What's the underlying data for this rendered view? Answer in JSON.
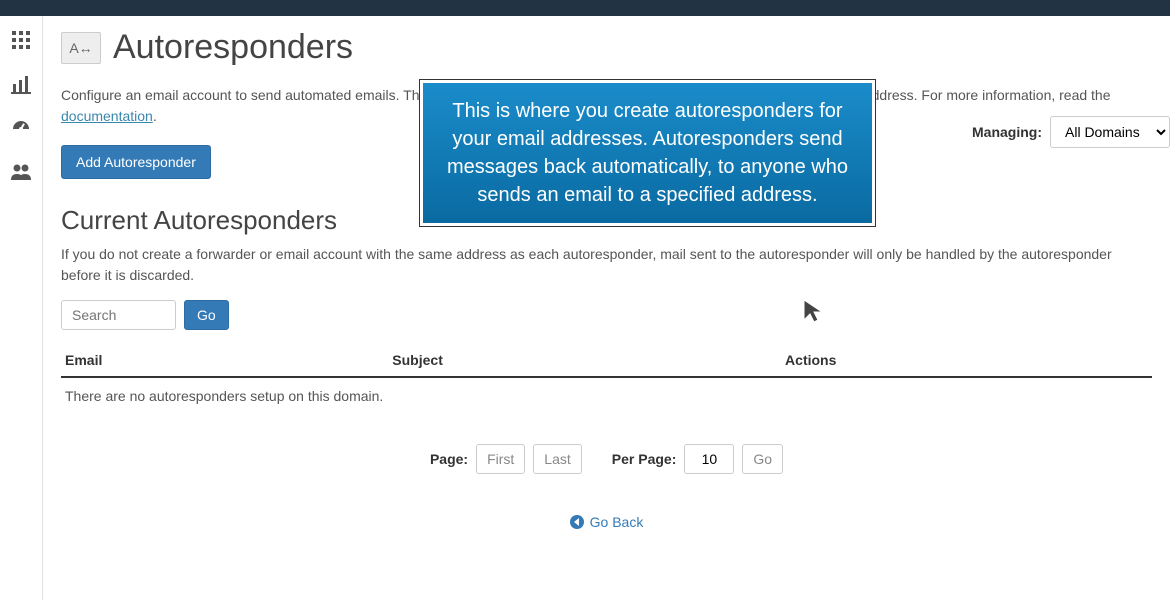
{
  "page": {
    "title": "Autoresponders",
    "icon_label": "A↔"
  },
  "managing": {
    "label": "Managing:",
    "selected": "All Domains"
  },
  "intro": {
    "text_before": "Configure an email account to send automated emails. This can be useful ... message that you wish to send from a support email address. For more information, read the ",
    "link_text": "documentation",
    "text_after": "."
  },
  "add_button_label": "Add Autoresponder",
  "section": {
    "title": "Current Autoresponders",
    "desc": "If you do not create a forwarder or email account with the same address as each autoresponder, mail sent to the autoresponder will only be handled by the autoresponder before it is discarded."
  },
  "search": {
    "placeholder": "Search",
    "go_label": "Go"
  },
  "table": {
    "col_email": "Email",
    "col_subject": "Subject",
    "col_actions": "Actions",
    "empty": "There are no autoresponders setup on this domain."
  },
  "pager": {
    "page_label": "Page:",
    "first_label": "First",
    "last_label": "Last",
    "perpage_label": "Per Page:",
    "perpage_value": "10",
    "go_label": "Go"
  },
  "goback_label": "Go Back",
  "tooltip": "This is where you create autoresponders for your email addresses. Autoresponders send messages back automatically, to anyone who sends an email to a specified address."
}
